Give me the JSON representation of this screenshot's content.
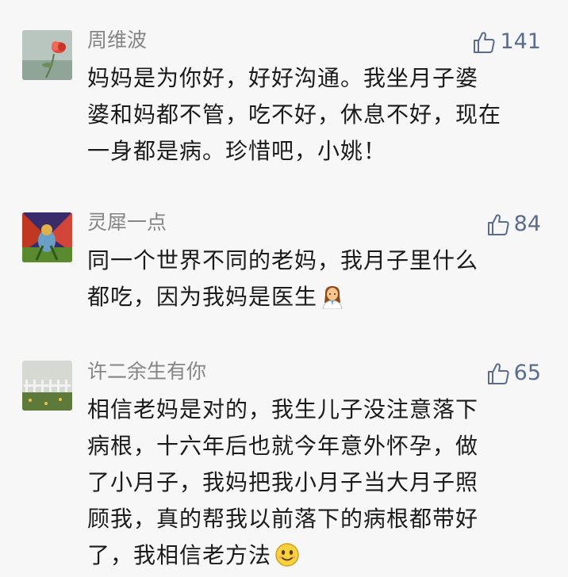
{
  "comments": [
    {
      "user": "周维波",
      "likes": "141",
      "lines": [
        "妈妈是为你好，好好沟通。我坐月子婆",
        "婆和妈都不管，吃不好，休息不好，现在",
        "一身都是病。珍惜吧，小姚！"
      ]
    },
    {
      "user": "灵犀一点",
      "likes": "84",
      "lines": [
        "同一个世界不同的老妈，我月子里什么",
        "都吃，因为我妈是医生"
      ]
    },
    {
      "user": "许二余生有你",
      "likes": "65",
      "lines": [
        "相信老妈是对的，我生儿子没注意落下",
        "病根，十六年后也就今年意外怀孕，做",
        "了小月子，我妈把我小月子当大月子照",
        "顾我，真的帮我以前落下的病根都带好",
        "了，我相信老方法"
      ]
    }
  ],
  "icons": {
    "like": "thumbs-up-icon",
    "doctor_emoji": "woman-health-worker-emoji",
    "smile_emoji": "smiling-face-emoji"
  },
  "colors": {
    "background": "#f7f7f7",
    "username": "#858585",
    "body_text": "#1b1b1b",
    "like": "#5b6c8f"
  }
}
